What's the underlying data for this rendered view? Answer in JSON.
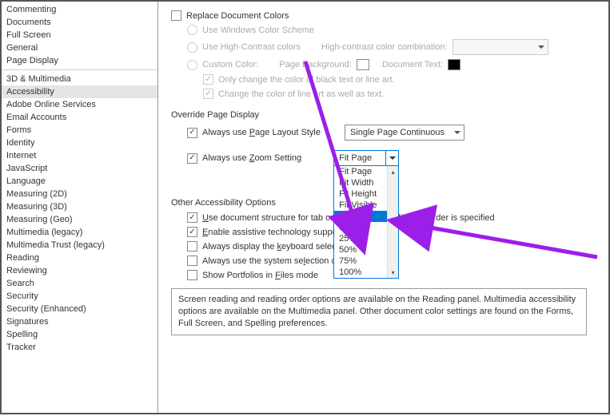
{
  "sidebar": {
    "group1": [
      "Commenting",
      "Documents",
      "Full Screen",
      "General",
      "Page Display"
    ],
    "group2": [
      "3D & Multimedia",
      "Accessibility",
      "Adobe Online Services",
      "Email Accounts",
      "Forms",
      "Identity",
      "Internet",
      "JavaScript",
      "Language",
      "Measuring (2D)",
      "Measuring (3D)",
      "Measuring (Geo)",
      "Multimedia (legacy)",
      "Multimedia Trust (legacy)",
      "Reading",
      "Reviewing",
      "Search",
      "Security",
      "Security (Enhanced)",
      "Signatures",
      "Spelling",
      "Tracker"
    ],
    "selected": "Accessibility"
  },
  "replaceColors": {
    "title": "Replace Document Colors",
    "opt1": "Use Windows Color Scheme",
    "opt2": "Use High-Contrast colors",
    "hcLabel": "High-contrast color combination:",
    "opt3": "Custom Color:",
    "pageBg": "Page Background:",
    "docText": "Document Text:",
    "onlyBlack": "Only change the color of black text or line art.",
    "changeLine": "Change the color of line art as well as text."
  },
  "override": {
    "title": "Override Page Display",
    "layout": "Always use Page Layout Style",
    "layoutValue": "Single Page Continuous",
    "zoom": "Always use Zoom Setting",
    "zoomValue": "Fit Page",
    "zoomOptions": [
      "Fit Page",
      "Fit Width",
      "Fit Height",
      "Fit Visible",
      "Reflow",
      "10%",
      "25%",
      "50%",
      "75%",
      "100%"
    ],
    "zoomHighlight": "Reflow"
  },
  "other": {
    "title": "Other Accessibility Options",
    "tab": "Use document structure for tab order when no explicit tab order is specified",
    "assistive": "Enable assistive technology support",
    "keyboard": "Always display the keyboard selection cursor",
    "system": "Always use the system selection color",
    "portfolios": "Show Portfolios in Files mode"
  },
  "info": "Screen reading and reading order options are available on the Reading panel. Multimedia accessibility options are available on the Multimedia panel. Other document color settings are found on the Forms, Full Screen, and Spelling preferences."
}
